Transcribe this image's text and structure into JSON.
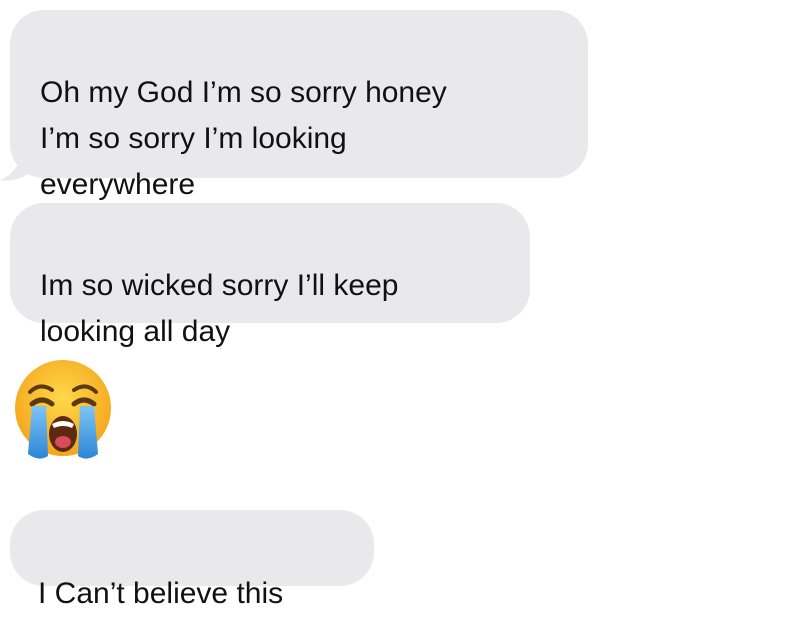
{
  "messages": [
    {
      "type": "text",
      "text": "Oh my God I’m so sorry honey\nI’m so sorry I’m looking\neverywhere"
    },
    {
      "type": "text",
      "text": "Im so wicked sorry I’ll keep\nlooking all day"
    },
    {
      "type": "emoji",
      "icon": "loudly-crying-face-icon"
    },
    {
      "type": "text",
      "text": "I Can’t believe this"
    }
  ],
  "colors": {
    "bubble_received": "#e9e9eb",
    "text": "#111111",
    "emoji_face": "#fbbd2f",
    "emoji_tears": "#3f9be3"
  }
}
